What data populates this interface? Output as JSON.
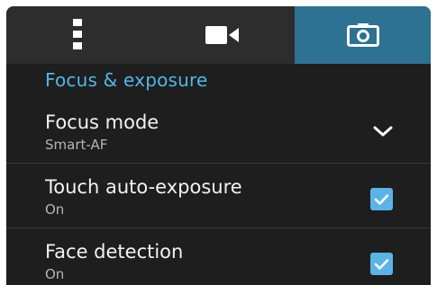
{
  "tabs": [
    {
      "name": "more",
      "icon": "more-vert-icon",
      "selected": false
    },
    {
      "name": "video",
      "icon": "video-camera-icon",
      "selected": false
    },
    {
      "name": "camera",
      "icon": "camera-icon",
      "selected": true
    }
  ],
  "section": {
    "title": "Focus & exposure"
  },
  "settings": [
    {
      "title": "Focus mode",
      "value": "Smart-AF",
      "control": "dropdown",
      "icon": "chevron-down-icon"
    },
    {
      "title": "Touch auto-exposure",
      "value": "On",
      "control": "checkbox",
      "checked": true
    },
    {
      "title": "Face detection",
      "value": "On",
      "control": "checkbox",
      "checked": true
    }
  ],
  "colors": {
    "accent": "#4fb7e8",
    "selected_tab": "#2d7193",
    "checkbox": "#5ab4e6",
    "background": "#1e1e1e",
    "tabbar": "#2d2d2d"
  }
}
